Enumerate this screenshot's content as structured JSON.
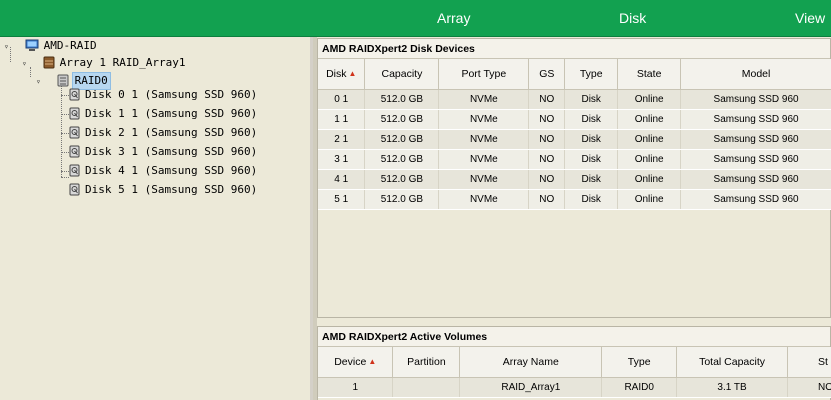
{
  "topbar": {
    "items": [
      "Array",
      "Disk",
      "View"
    ]
  },
  "tree": {
    "root": "AMD-RAID",
    "array": "Array 1 RAID_Array1",
    "volume": "RAID0",
    "disks": [
      "Disk 0 1 (Samsung SSD 960)",
      "Disk 1 1 (Samsung SSD 960)",
      "Disk 2 1 (Samsung SSD 960)",
      "Disk 3 1 (Samsung SSD 960)",
      "Disk 4 1 (Samsung SSD 960)",
      "Disk 5 1 (Samsung SSD 960)"
    ]
  },
  "disk_panel": {
    "title": "AMD RAIDXpert2 Disk Devices",
    "columns": [
      "Disk",
      "Capacity",
      "Port Type",
      "GS",
      "Type",
      "State",
      "Model"
    ],
    "sort_icon": "sort-asc-icon",
    "rows": [
      [
        "0 1",
        "512.0 GB",
        "NVMe",
        "NO",
        "Disk",
        "Online",
        "Samsung SSD 960"
      ],
      [
        "1 1",
        "512.0 GB",
        "NVMe",
        "NO",
        "Disk",
        "Online",
        "Samsung SSD 960"
      ],
      [
        "2 1",
        "512.0 GB",
        "NVMe",
        "NO",
        "Disk",
        "Online",
        "Samsung SSD 960"
      ],
      [
        "3 1",
        "512.0 GB",
        "NVMe",
        "NO",
        "Disk",
        "Online",
        "Samsung SSD 960"
      ],
      [
        "4 1",
        "512.0 GB",
        "NVMe",
        "NO",
        "Disk",
        "Online",
        "Samsung SSD 960"
      ],
      [
        "5 1",
        "512.0 GB",
        "NVMe",
        "NO",
        "Disk",
        "Online",
        "Samsung SSD 960"
      ]
    ]
  },
  "volume_panel": {
    "title": "AMD RAIDXpert2 Active Volumes",
    "columns": [
      "Device",
      "Partition",
      "Array Name",
      "Type",
      "Total Capacity",
      "St"
    ],
    "rows": [
      [
        "1",
        "",
        "RAID_Array1",
        "RAID0",
        "3.1 TB",
        "NOR"
      ]
    ]
  },
  "colors": {
    "topbar": "#12a150",
    "selection": "#b7d7f0"
  }
}
